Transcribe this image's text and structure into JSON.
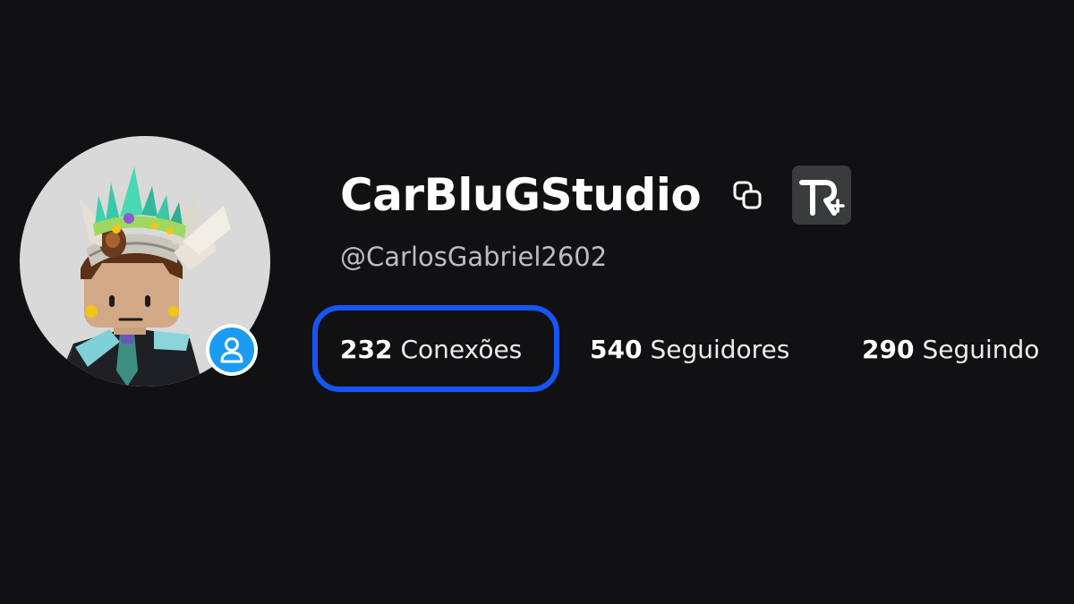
{
  "profile": {
    "display_name": "CarBluGStudio",
    "username": "@CarlosGabriel2602",
    "avatar_icon": "roblox-avatar-headshot",
    "presence_icon": "user-silhouette-icon",
    "presence_color": "#1a9cf2",
    "copy_icon": "copy-icon",
    "premium_badge_icon": "roblox-plus-icon",
    "premium_badge_text": "R+"
  },
  "stats": {
    "connections": {
      "count": "232",
      "label": "Conexões"
    },
    "followers": {
      "count": "540",
      "label": "Seguidores"
    },
    "following": {
      "count": "290",
      "label": "Seguindo"
    }
  },
  "colors": {
    "background": "#111113",
    "highlight_outline": "#1556f5",
    "username_text": "#bdbebf",
    "badge_background": "#393b3d"
  }
}
